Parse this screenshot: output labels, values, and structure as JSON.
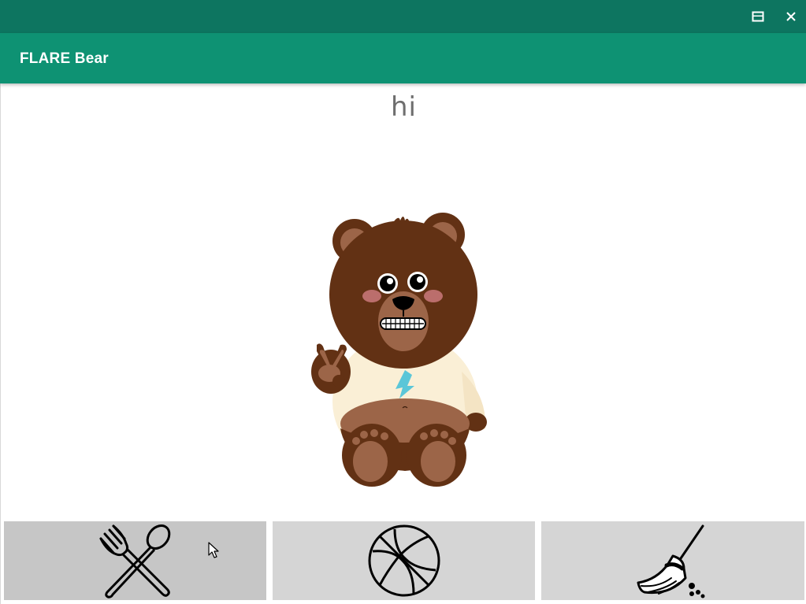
{
  "window": {
    "buttons": {
      "maximize_icon": "maximize-icon",
      "close_icon": "close-icon"
    }
  },
  "appbar": {
    "title": "FLARE Bear"
  },
  "bear": {
    "speech": "hi",
    "shirt_logo_color": "#5bc6d8"
  },
  "actions": [
    {
      "icon": "fork-spoon-icon",
      "state": "hovered"
    },
    {
      "icon": "basketball-icon",
      "state": "normal"
    },
    {
      "icon": "broom-icon",
      "state": "normal"
    }
  ],
  "colors": {
    "titlebar": "#0d7560",
    "appbar": "#0e9273",
    "button_bg": "#d5d5d5",
    "button_bg_hover": "#c6c6c6",
    "bear_fur": "#623114",
    "bear_light": "#9c6548",
    "shirt": "#faefd6"
  }
}
